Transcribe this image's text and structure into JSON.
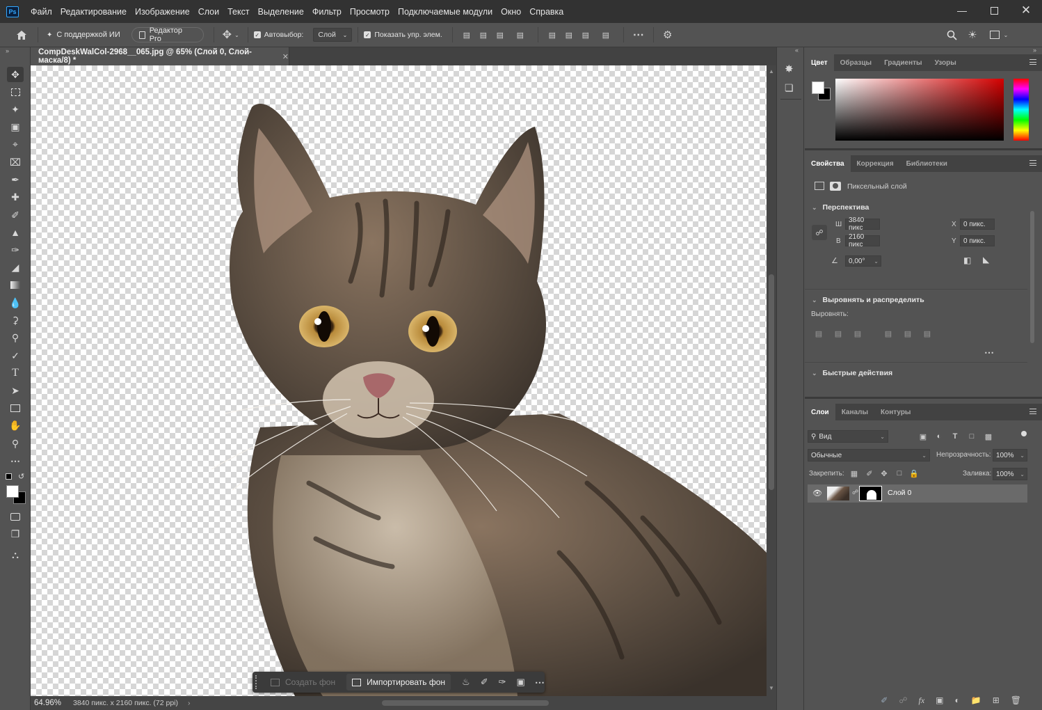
{
  "menu": [
    "Файл",
    "Редактирование",
    "Изображение",
    "Слои",
    "Текст",
    "Выделение",
    "Фильтр",
    "Просмотр",
    "Подключаемые модули",
    "Окно",
    "Справка"
  ],
  "options": {
    "ai_support": "С поддержкой ИИ",
    "pro_editor": "Редактор Pro",
    "autoselect_label": "Автовыбор:",
    "autoselect_value": "Слой",
    "show_transform": "Показать упр. элем."
  },
  "document": {
    "tab_title": "CompDeskWalCol-2968__065.jpg @ 65% (Слой 0, Слой-маска/8) *",
    "zoom": "64.96%",
    "info": "3840 пикс. x 2160 пикс. (72 ppi)"
  },
  "floating_bar": {
    "create_bg": "Создать фон",
    "import_bg": "Импортировать фон"
  },
  "color_panel": {
    "tabs": [
      "Цвет",
      "Образцы",
      "Градиенты",
      "Узоры"
    ],
    "hue_color": "#ff0000"
  },
  "properties": {
    "tabs": [
      "Свойства",
      "Коррекция",
      "Библиотеки"
    ],
    "layer_type": "Пиксельный слой",
    "transform_title": "Перспектива",
    "w_label": "Ш",
    "w_value": "3840 пикс",
    "h_label": "В",
    "h_value": "2160 пикс",
    "x_label": "X",
    "x_value": "0 пикс.",
    "y_label": "Y",
    "y_value": "0 пикс.",
    "angle": "0,00°",
    "align_title": "Выровнять и распределить",
    "align_label": "Выровнять:",
    "quick_actions": "Быстрые действия"
  },
  "layers": {
    "tabs": [
      "Слои",
      "Каналы",
      "Контуры"
    ],
    "filter": "Вид",
    "blend_mode": "Обычные",
    "opacity_label": "Непрозрачность:",
    "opacity_value": "100%",
    "lock_label": "Закрепить:",
    "fill_label": "Заливка:",
    "fill_value": "100%",
    "items": [
      {
        "name": "Слой 0"
      }
    ]
  }
}
